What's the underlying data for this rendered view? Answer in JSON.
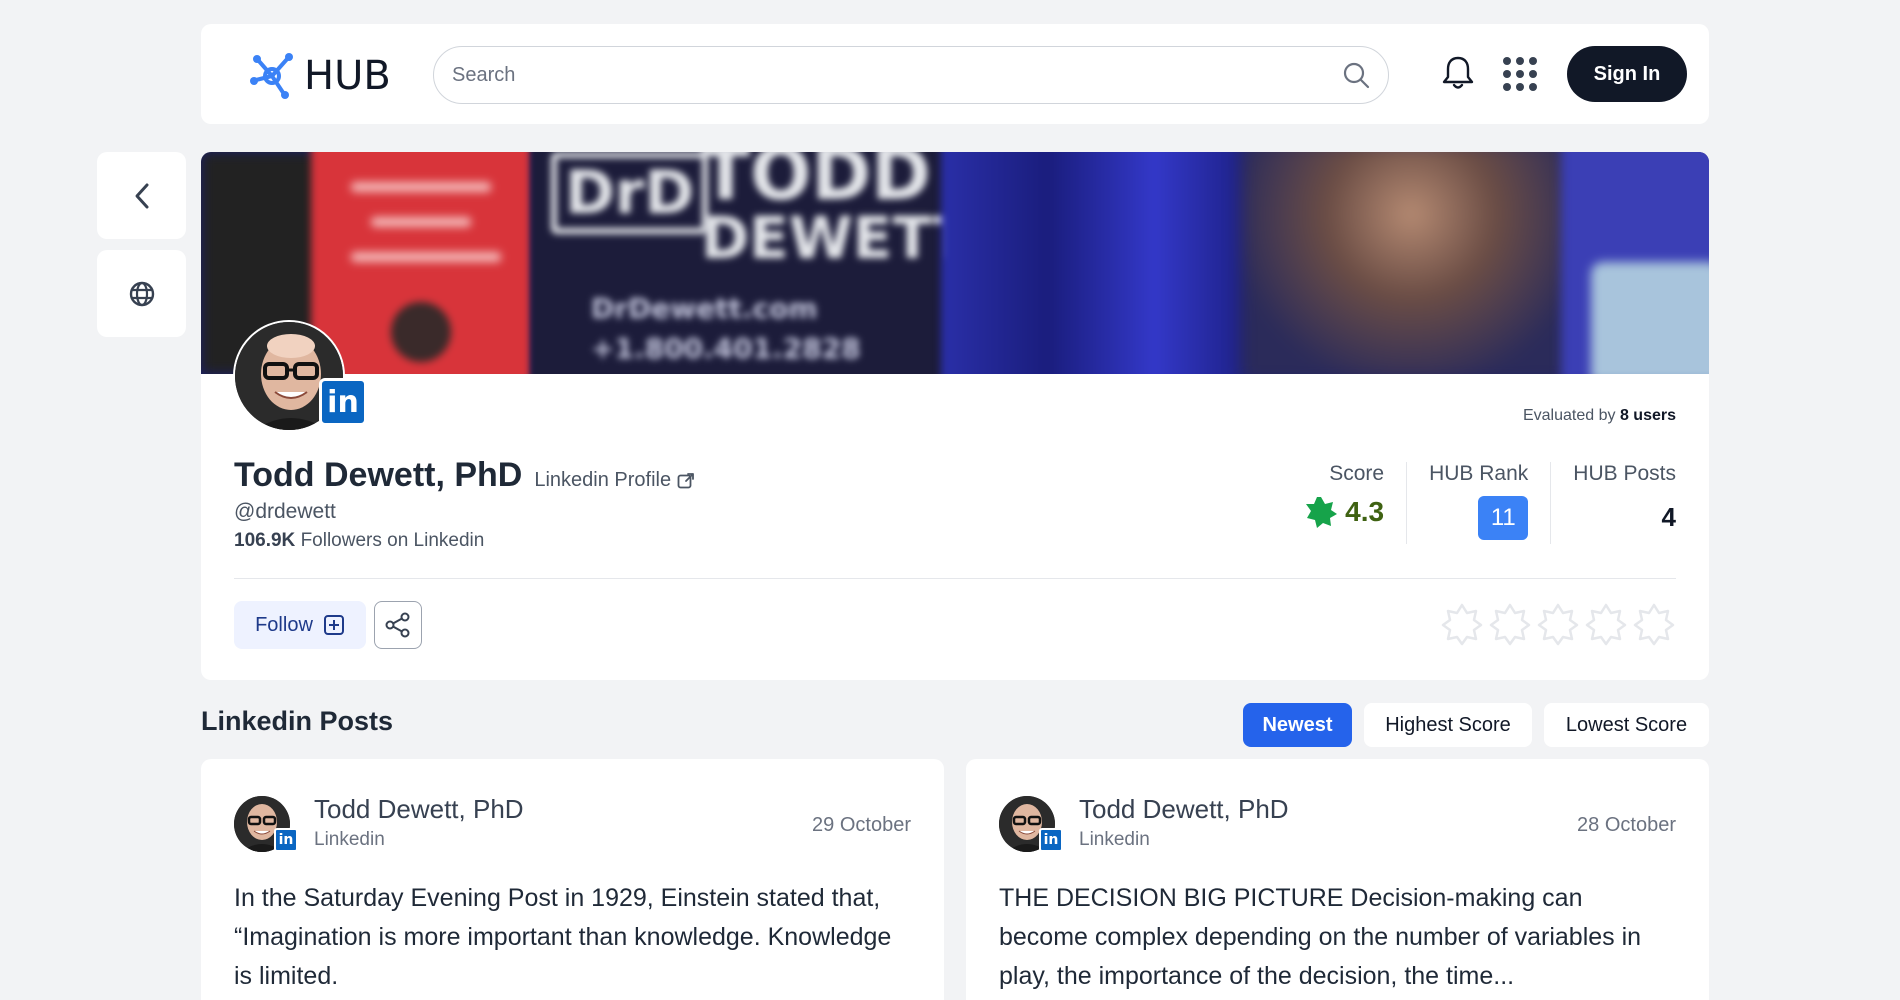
{
  "header": {
    "logo_text": "HUB",
    "search_placeholder": "Search",
    "signin_label": "Sign In",
    "icons": {
      "logo": "hub-logo-icon",
      "search": "search-icon",
      "bell": "bell-icon",
      "apps": "apps-grid-icon"
    }
  },
  "side": {
    "back_icon": "chevron-left-icon",
    "globe_icon": "globe-icon"
  },
  "profile": {
    "banner_text_1": "TODD",
    "banner_text_2": "DEWETT",
    "banner_text_3": "DrDewett.com",
    "banner_text_4": "+1.800.401.2828",
    "banner_logo": "DrD",
    "name": "Todd Dewett, PhD",
    "linkedin_profile_label": "Linkedin Profile",
    "handle": "@drdewett",
    "followers_count": "106.9K",
    "followers_suffix": "Followers on Linkedin",
    "evaluated_prefix": "Evaluated by",
    "evaluated_count": "8 users",
    "badge_text": "in",
    "stats": {
      "score_label": "Score",
      "score_value": "4.3",
      "rank_label": "HUB Rank",
      "rank_value": "11",
      "posts_label": "HUB Posts",
      "posts_value": "4"
    },
    "follow_label": "Follow",
    "rating": {
      "filled": 0,
      "max": 5
    },
    "colors": {
      "accent": "#2563eb",
      "score_star": "#16a34a",
      "linkedin": "#0a66c2"
    }
  },
  "posts_section": {
    "title": "Linkedin Posts",
    "sort_options": [
      "Newest",
      "Highest Score",
      "Lowest Score"
    ],
    "active_sort": "Newest",
    "posts": [
      {
        "author": "Todd Dewett, PhD",
        "source": "Linkedin",
        "date": "29 October",
        "text": "In the Saturday Evening Post in 1929, Einstein stated that, “Imagination is more important than knowledge. Knowledge is limited."
      },
      {
        "author": "Todd Dewett, PhD",
        "source": "Linkedin",
        "date": "28 October",
        "text": "THE DECISION BIG PICTURE Decision-making can become complex depending on the number of variables in play, the importance of the decision, the time..."
      }
    ]
  }
}
